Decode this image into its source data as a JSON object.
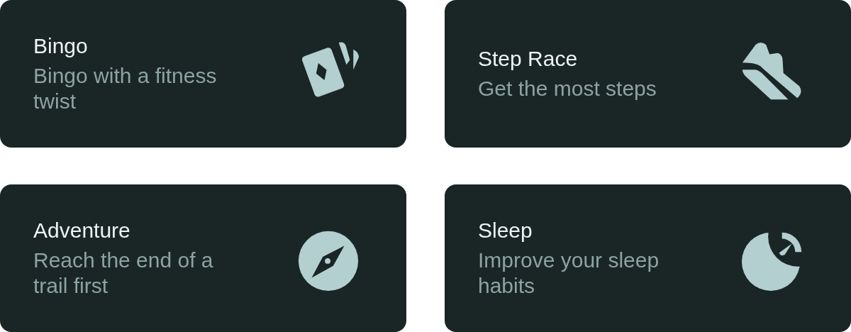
{
  "cards": [
    {
      "title": "Bingo",
      "description": "Bingo with a fitness twist"
    },
    {
      "title": "Step Race",
      "description": "Get the most steps"
    },
    {
      "title": "Adventure",
      "description": "Reach the end of a trail first"
    },
    {
      "title": "Sleep",
      "description": "Improve your sleep habits"
    }
  ]
}
